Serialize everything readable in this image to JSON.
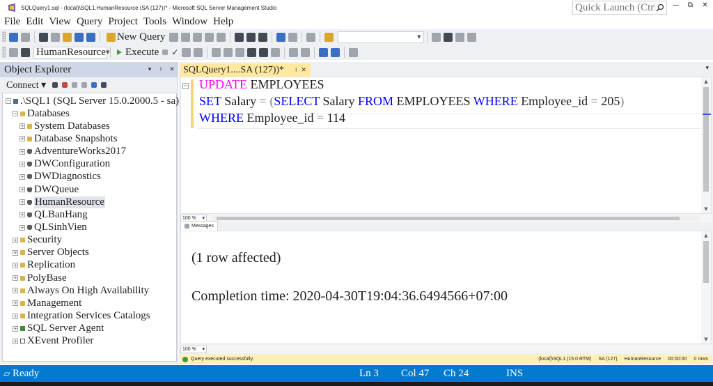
{
  "window": {
    "title": "SQLQuery1.sql - (local)\\SQL1.HumanResource (SA (127))* - Microsoft SQL Server Management Studio",
    "quick_launch_placeholder": "Quick Launch (Ctrl+Q)",
    "controls": [
      "minimize-icon",
      "restore-icon",
      "close-icon"
    ]
  },
  "menu": [
    "File",
    "Edit",
    "View",
    "Query",
    "Project",
    "Tools",
    "Window",
    "Help"
  ],
  "toolbar": {
    "new_query_label": "New Query",
    "database_combo": "HumanResource",
    "execute_label": "Execute"
  },
  "object_explorer": {
    "title": "Object Explorer",
    "connect_label": "Connect",
    "tree": [
      {
        "label": ".\\SQL1 (SQL Server 15.0.2000.5 - sa)",
        "icon": "server-icon",
        "expanded": true
      },
      {
        "label": "Databases",
        "icon": "folder-icon",
        "expanded": true
      },
      {
        "label": "System Databases",
        "icon": "folder-icon"
      },
      {
        "label": "Database Snapshots",
        "icon": "folder-icon"
      },
      {
        "label": "AdventureWorks2017",
        "icon": "database-icon"
      },
      {
        "label": "DWConfiguration",
        "icon": "database-icon"
      },
      {
        "label": "DWDiagnostics",
        "icon": "database-icon"
      },
      {
        "label": "DWQueue",
        "icon": "database-icon"
      },
      {
        "label": "HumanResource",
        "icon": "database-icon",
        "selected": true
      },
      {
        "label": "QLBanHang",
        "icon": "database-icon"
      },
      {
        "label": "QLSinhVien",
        "icon": "database-icon"
      },
      {
        "label": "Security",
        "icon": "folder-icon"
      },
      {
        "label": "Server Objects",
        "icon": "folder-icon"
      },
      {
        "label": "Replication",
        "icon": "folder-icon"
      },
      {
        "label": "PolyBase",
        "icon": "folder-icon"
      },
      {
        "label": "Always On High Availability",
        "icon": "folder-icon"
      },
      {
        "label": "Management",
        "icon": "folder-icon"
      },
      {
        "label": "Integration Services Catalogs",
        "icon": "folder-icon"
      },
      {
        "label": "SQL Server Agent",
        "icon": "agent-icon"
      },
      {
        "label": "XEvent Profiler",
        "icon": "xevent-icon"
      }
    ]
  },
  "document": {
    "tab_label": "SQLQuery1....SA (127))*",
    "code": {
      "line1": {
        "kw": "UPDATE",
        "rest": " EMPLOYEES"
      },
      "line2": {
        "kw1": "SET",
        "t1": " Salary ",
        "op1": "=",
        "t2": " ",
        "op2": "(",
        "kw2": "SELECT",
        "t3": " Salary ",
        "kw3": "FROM",
        "t4": " EMPLOYEES ",
        "kw4": "WHERE",
        "t5": " Employee_id ",
        "op3": "=",
        "t6": " 205",
        "op4": ")"
      },
      "line3": {
        "kw": "WHERE",
        "t1": " Employee_id ",
        "op": "=",
        "t2": " 114"
      }
    },
    "zoom": "100 %",
    "results_zoom": "100 %",
    "messages_tab": "Messages",
    "messages": [
      "(1 row affected)",
      "Completion time: 2020-04-30T19:04:36.6494566+07:00"
    ]
  },
  "query_status": {
    "message": "Query executed successfully.",
    "server": "(local)\\SQL1 (15.0 RTM)",
    "login": "SA (127)",
    "database": "HumanResource",
    "elapsed": "00:00:00",
    "rows": "0 rows"
  },
  "statusbar": {
    "ready": "Ready",
    "ln": "Ln 3",
    "col": "Col 47",
    "ch": "Ch 24",
    "ins": "INS"
  },
  "colors": {
    "statusbar": "#007acc",
    "doc_tab": "#ffe9a0",
    "query_status": "#fff1b5",
    "keyword": "#0000ff",
    "update_keyword": "#ff00ff"
  }
}
